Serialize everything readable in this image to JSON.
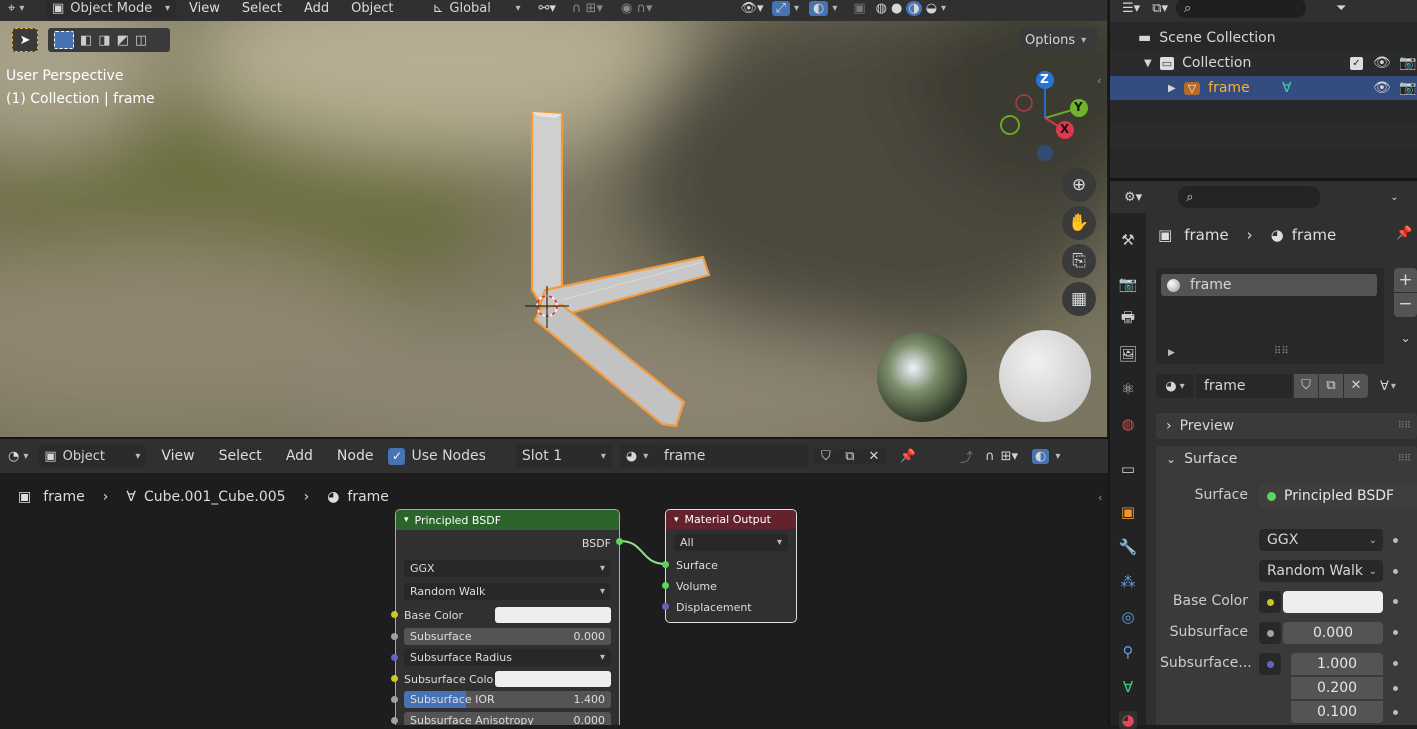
{
  "viewport": {
    "header": {
      "mode": "Object Mode",
      "menus": [
        "View",
        "Select",
        "Add",
        "Object"
      ],
      "orientation": "Global",
      "options": "Options"
    },
    "overlay_line1": "User Perspective",
    "overlay_line2": "(1) Collection | frame",
    "gizmo": {
      "z": "Z",
      "y": "Y",
      "x": "X"
    }
  },
  "outliner": {
    "scene_collection": "Scene Collection",
    "collection": "Collection",
    "object": "frame"
  },
  "node_editor": {
    "header": {
      "editor": "Object",
      "menus": [
        "View",
        "Select",
        "Add",
        "Node"
      ],
      "use_nodes": "Use Nodes",
      "slot": "Slot 1",
      "material": "frame"
    },
    "breadcrumb": {
      "object": "frame",
      "mesh": "Cube.001_Cube.005",
      "material": "frame"
    },
    "bsdf": {
      "title": "Principled BSDF",
      "output": "BSDF",
      "distribution": "GGX",
      "subsurface_method": "Random Walk",
      "base_color": "Base Color",
      "subsurface": "Subsurface",
      "subsurface_value": "0.000",
      "subsurface_radius": "Subsurface Radius",
      "subsurface_color": "Subsurface Colo",
      "subsurface_ior": "Subsurface IOR",
      "subsurface_ior_value": "1.400",
      "subsurface_aniso": "Subsurface Anisotropy",
      "subsurface_aniso_value": "0.000"
    },
    "output_node": {
      "title": "Material Output",
      "target": "All",
      "surface": "Surface",
      "volume": "Volume",
      "displacement": "Displacement"
    }
  },
  "properties": {
    "breadcrumb_object": "frame",
    "breadcrumb_material": "frame",
    "slot_name": "frame",
    "material_name": "frame",
    "preview": "Preview",
    "surface_panel": "Surface",
    "surface_label": "Surface",
    "surface_value": "Principled BSDF",
    "distribution": "GGX",
    "subsurface_method": "Random Walk",
    "base_color": "Base Color",
    "subsurface": "Subsurface",
    "subsurface_value": "0.000",
    "subsurface_radius": "Subsurface...",
    "radius_values": [
      "1.000",
      "0.200",
      "0.100"
    ]
  },
  "colors": {
    "accent": "#4772b3",
    "selection_outline": "#f59a3a",
    "header": "#303030",
    "bsdf_header": "#2b652b",
    "output_header": "#63222c"
  }
}
